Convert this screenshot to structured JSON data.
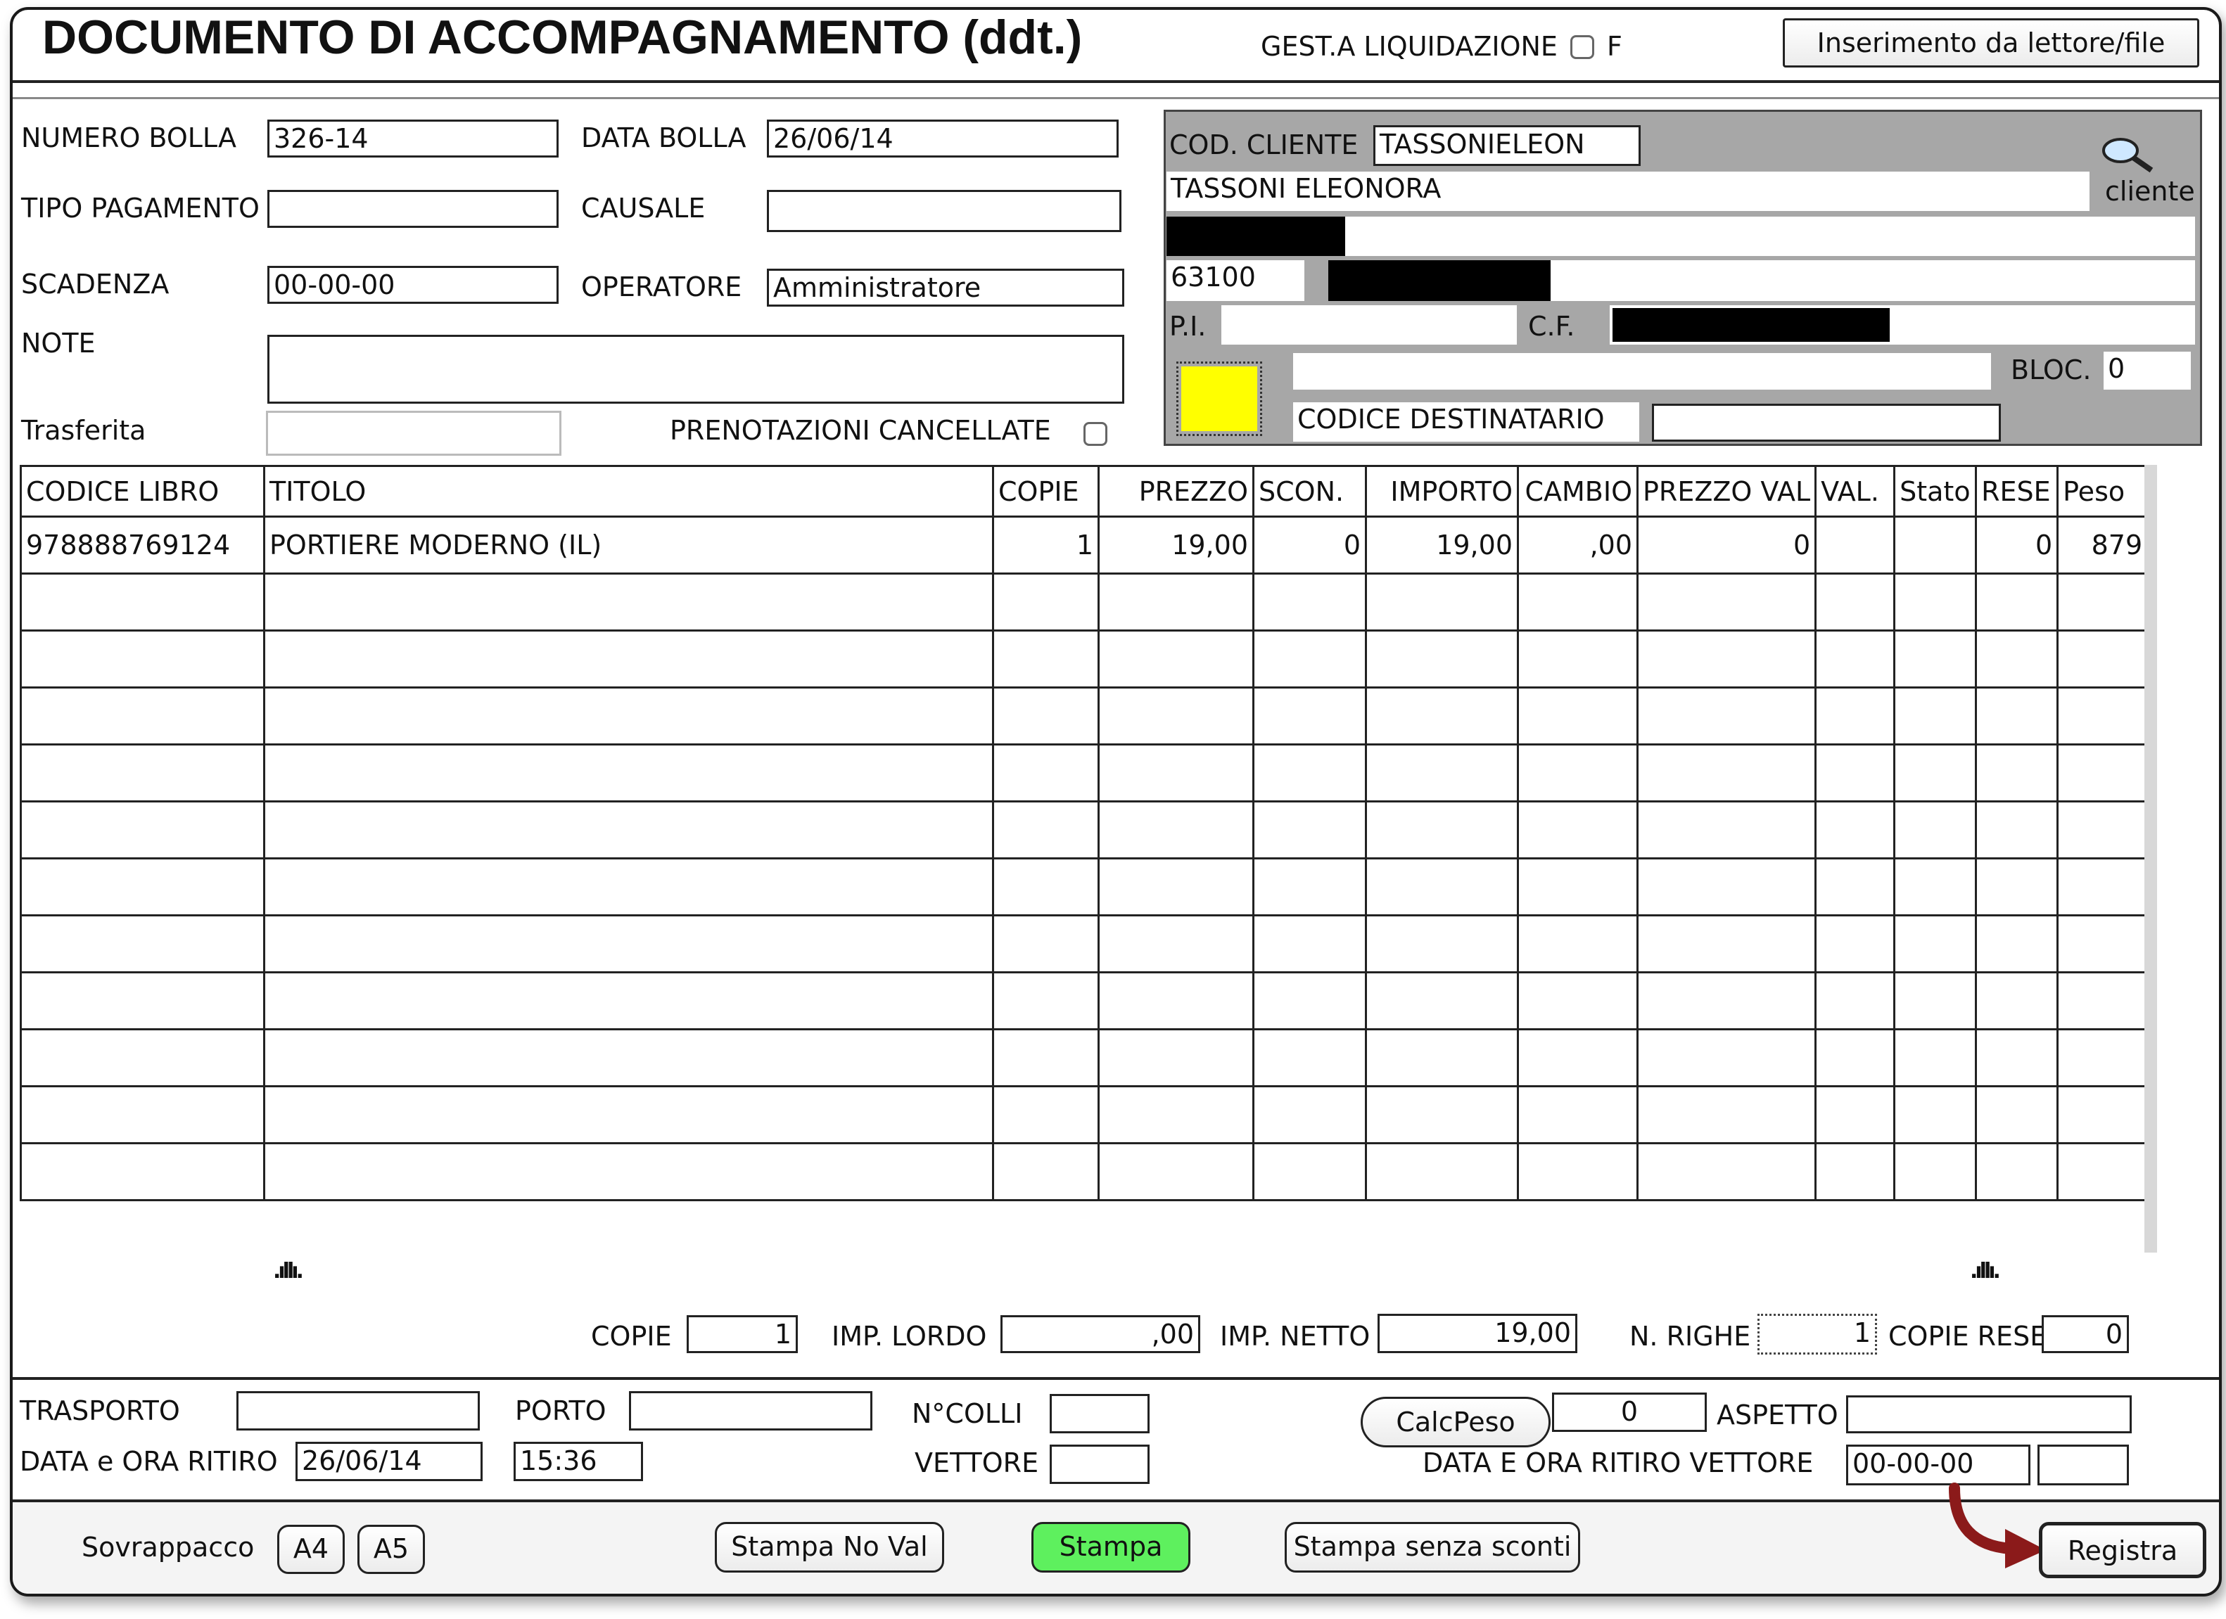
{
  "header": {
    "title": "DOCUMENTO DI ACCOMPAGNAMENTO  (ddt.)",
    "gest_label": "GEST.A LIQUIDAZIONE",
    "f_label": "F",
    "import_button": "Inserimento da lettore/file"
  },
  "form": {
    "numero_bolla_label": "NUMERO BOLLA",
    "numero_bolla": "326-14",
    "data_bolla_label": "DATA BOLLA",
    "data_bolla": "26/06/14",
    "tipo_pagamento_label": "TIPO PAGAMENTO",
    "tipo_pagamento": "",
    "causale_label": "CAUSALE",
    "causale": "",
    "scadenza_label": "SCADENZA",
    "scadenza": "00-00-00",
    "operatore_label": "OPERATORE",
    "operatore": "Amministratore",
    "note_label": "NOTE",
    "note": "",
    "trasferita_label": "Trasferita",
    "trasferita": "",
    "prenotazioni_label": "PRENOTAZIONI CANCELLATE"
  },
  "cliente": {
    "cod_label": "COD. CLIENTE",
    "cod": "TASSONIELEON",
    "lookup_label": "cliente",
    "nome": "TASSONI ELEONORA",
    "cap": "63100",
    "pi_label": "P.I.",
    "cf_label": "C.F.",
    "bloc_label": "BLOC.",
    "bloc": "0",
    "codice_dest_label": "CODICE DESTINATARIO",
    "codice_dest": "",
    "color_swatch": "#ffff00"
  },
  "table": {
    "headers": [
      "CODICE LIBRO",
      "TITOLO",
      "COPIE",
      "PREZZO",
      "SCON.",
      "IMPORTO",
      "CAMBIO",
      "PREZZO VAL",
      "VAL.",
      "Stato",
      "RESE",
      "Peso"
    ],
    "rows": [
      [
        "9788887691​24",
        "PORTIERE MODERNO (IL)",
        "1",
        "19,00",
        "0",
        "19,00",
        ",00",
        "0",
        "",
        "",
        "0",
        "879"
      ]
    ]
  },
  "totals": {
    "copie_label": "COPIE",
    "copie": "1",
    "imp_lordo_label": "IMP. LORDO",
    "imp_lordo": ",00",
    "imp_netto_label": "IMP. NETTO",
    "imp_netto": "19,00",
    "n_righe_label": "N. RIGHE",
    "n_righe": "1",
    "copie_rese_label": "COPIE RESE",
    "copie_rese": "0"
  },
  "transport": {
    "trasporto_label": "TRASPORTO",
    "trasporto": "",
    "porto_label": "PORTO",
    "porto": "",
    "ncolli_label": "N°COLLI",
    "ncolli": "",
    "vettore_label": "VETTORE",
    "vettore": "",
    "data_ritiro_label": "DATA e ORA RITIRO",
    "data_ritiro": "26/06/14",
    "ora_ritiro": "15:36",
    "calcpeso_button": "CalcPeso",
    "peso": "0",
    "aspetto_label": "ASPETTO",
    "aspetto": "",
    "data_vettore_label": "DATA E ORA RITIRO VETTORE",
    "data_vettore": "00-00-00",
    "ora_vettore": ""
  },
  "footer": {
    "sovrappacco_label": "Sovrappacco",
    "a4": "A4",
    "a5": "A5",
    "stampa_no_val": "Stampa No Val",
    "stampa": "Stampa",
    "stampa_senza_sconti": "Stampa senza sconti",
    "registra": "Registra",
    "stampa_color": "#5ef05e",
    "arrow_color": "#8b1a1a"
  }
}
